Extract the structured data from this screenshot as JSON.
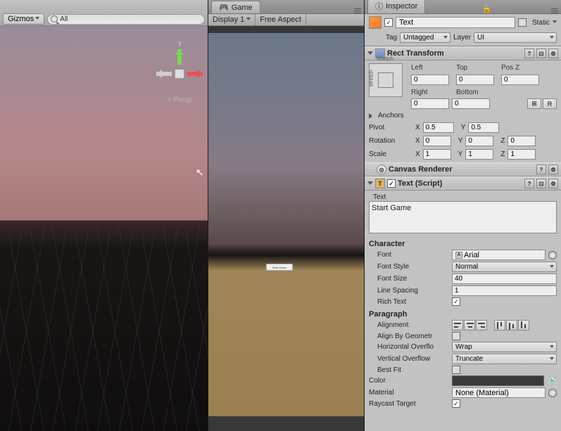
{
  "scene": {
    "gizmos_label": "Gizmos",
    "search_text": "All",
    "gizmo_axis_y": "y",
    "persp_label": "Persp"
  },
  "game": {
    "tab_label": "Game",
    "display_label": "Display 1",
    "aspect_label": "Free Aspect",
    "button_text": "Start Game"
  },
  "inspector": {
    "tab_label": "Inspector",
    "name": "Text",
    "static_label": "Static",
    "tag_label": "Tag",
    "tag_value": "Untagged",
    "layer_label": "Layer",
    "layer_value": "UI",
    "rect": {
      "title": "Rect Transform",
      "stretch": "stretch",
      "left_label": "Left",
      "left": "0",
      "top_label": "Top",
      "top": "0",
      "posz_label": "Pos Z",
      "posz": "0",
      "right_label": "Right",
      "right": "0",
      "bottom_label": "Bottom",
      "bottom": "0",
      "grid_btn": "⊞",
      "r_btn": "R",
      "anchors_label": "Anchors",
      "pivot_label": "Pivot",
      "pivot_x": "0.5",
      "pivot_y": "0.5",
      "rotation_label": "Rotation",
      "rot_x": "0",
      "rot_y": "0",
      "rot_z": "0",
      "scale_label": "Scale",
      "scl_x": "1",
      "scl_y": "1",
      "scl_z": "1",
      "x": "X",
      "y": "Y",
      "z": "Z"
    },
    "canvas": {
      "title": "Canvas Renderer"
    },
    "text": {
      "title": "Text (Script)",
      "text_label": "Text",
      "text_value": "Start Game",
      "character_label": "Character",
      "font_label": "Font",
      "font_value": "Arial",
      "fontstyle_label": "Font Style",
      "fontstyle_value": "Normal",
      "fontsize_label": "Font Size",
      "fontsize_value": "40",
      "linespacing_label": "Line Spacing",
      "linespacing_value": "1",
      "richtext_label": "Rich Text",
      "paragraph_label": "Paragraph",
      "alignment_label": "Alignment",
      "alignbygeo_label": "Align By Geometr",
      "hoverflow_label": "Horizontal Overflo",
      "hoverflow_value": "Wrap",
      "voverflow_label": "Vertical Overflow",
      "voverflow_value": "Truncate",
      "bestfit_label": "Best Fit",
      "color_label": "Color",
      "color_value": "#3a3a3a",
      "material_label": "Material",
      "material_value": "None (Material)",
      "raycast_label": "Raycast Target"
    }
  }
}
